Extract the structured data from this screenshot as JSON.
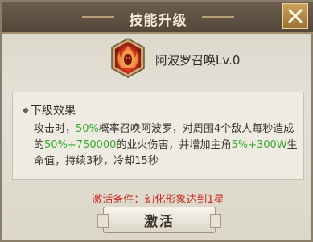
{
  "dialog": {
    "title": "技能升级",
    "close_icon": "close-icon"
  },
  "skill": {
    "icon": "flame-demon-icon",
    "name": "阿波罗召唤Lv.0"
  },
  "description": {
    "header": "下级效果",
    "segments": [
      {
        "text": "攻击时，",
        "highlight": false
      },
      {
        "text": "50%",
        "highlight": true
      },
      {
        "text": "概率召唤阿波罗，对周围4个敌人每秒造成的",
        "highlight": false
      },
      {
        "text": "50%+750000",
        "highlight": true
      },
      {
        "text": "的业火伤害，并增加主角",
        "highlight": false
      },
      {
        "text": "5%+300W",
        "highlight": true
      },
      {
        "text": "生命值，持续3秒，冷却15秒",
        "highlight": false
      }
    ]
  },
  "condition": "激活条件：幻化形象达到1星",
  "activate_label": "激活",
  "colors": {
    "highlight": "#3aa82e",
    "condition": "#cc2a1f",
    "title_bar": "#5e5042"
  }
}
